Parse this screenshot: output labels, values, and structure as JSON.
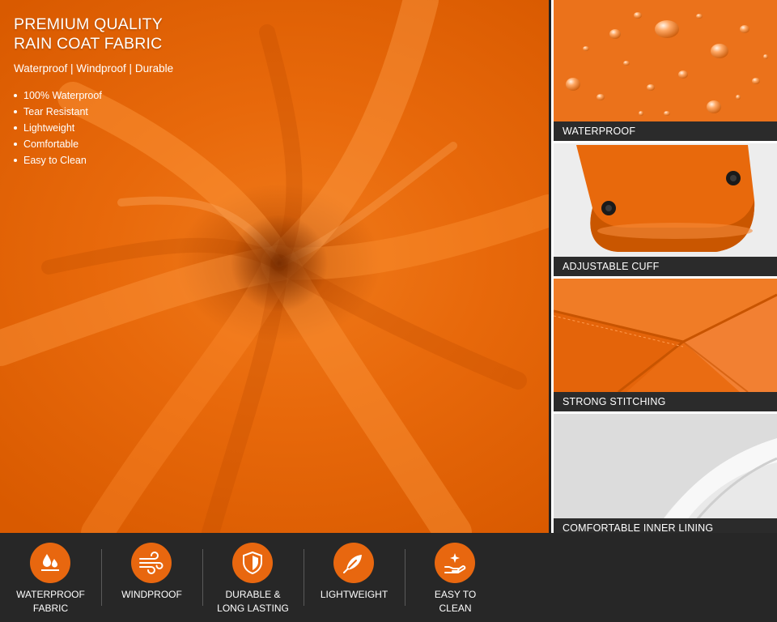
{
  "hero": {
    "title": "PREMIUM QUALITY\nRAIN COAT FABRIC",
    "subtitle": "Waterproof | Windproof | Durable",
    "bullets": [
      "100% Waterproof",
      "Tear Resistant",
      "Lightweight",
      "Comfortable",
      "Easy to Clean"
    ]
  },
  "tiles": [
    {
      "label": "WATERPROOF",
      "image": "water-droplets-on-orange-fabric"
    },
    {
      "label": "ADJUSTABLE CUFF",
      "image": "orange-sleeve-cuff-with-snap-buttons"
    },
    {
      "label": "STRONG STITCHING",
      "image": "orange-fabric-seam-stitching"
    },
    {
      "label": "COMFORTABLE INNER LINING",
      "image": "white-inner-lining-fabric"
    }
  ],
  "features": [
    {
      "label": "WATERPROOF\nFABRIC",
      "icon": "water-drops-icon"
    },
    {
      "label": "WINDPROOF",
      "icon": "wind-icon"
    },
    {
      "label": "DURABLE &\nLONG LASTING",
      "icon": "shield-icon"
    },
    {
      "label": "LIGHTWEIGHT",
      "icon": "feather-icon"
    },
    {
      "label": "EASY TO\nCLEAN",
      "icon": "clean-hand-sparkle-icon"
    }
  ],
  "colors": {
    "accent": "#e8670f",
    "fabric": "#e8690b",
    "label_bar": "#2b2b2b",
    "footer": "#272727"
  }
}
